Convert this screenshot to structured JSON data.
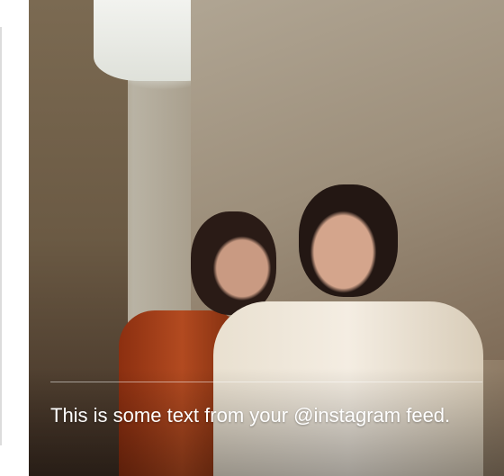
{
  "feed": {
    "caption": "This is some text from your @instagram feed."
  }
}
